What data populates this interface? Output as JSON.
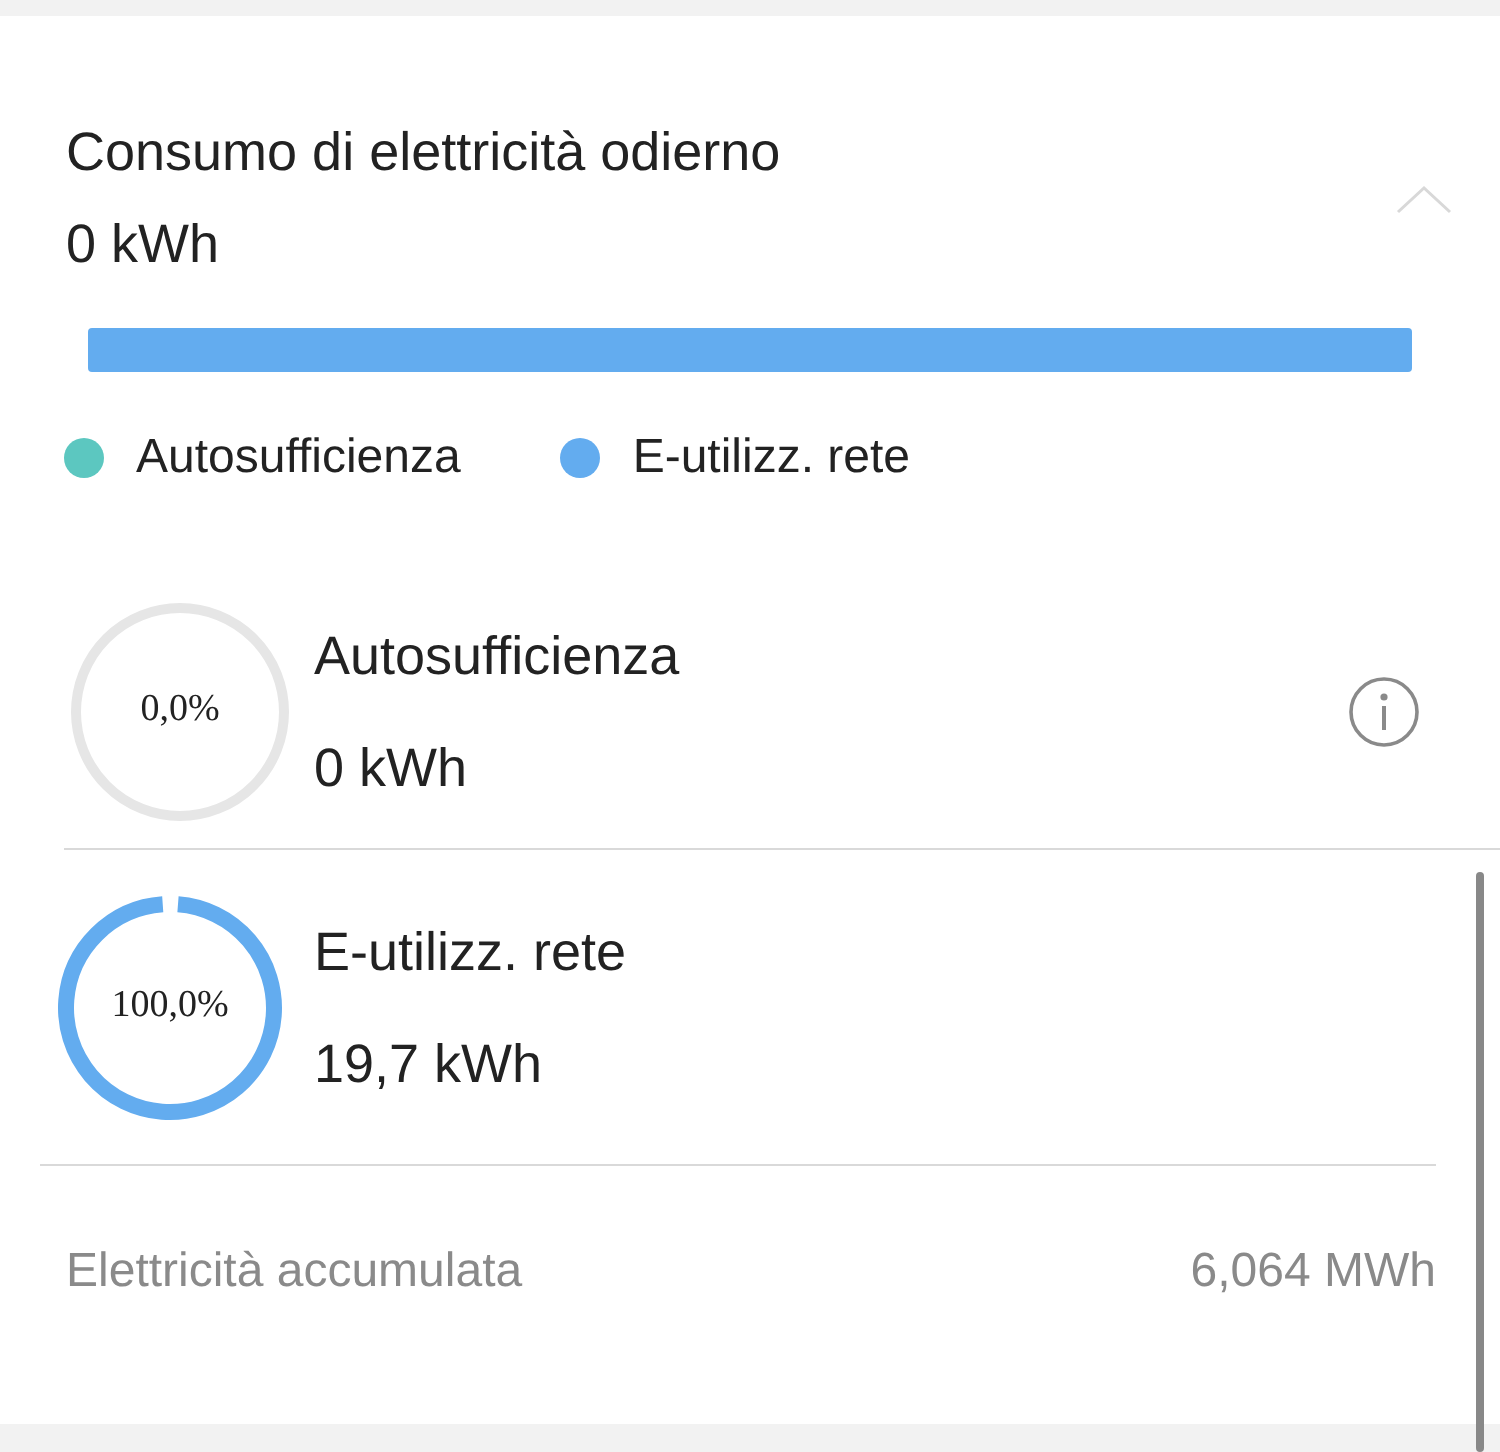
{
  "title": "Consumo di elettricità odierno",
  "total": "0 kWh",
  "expanded": true,
  "bar": [
    {
      "color": "#63acef",
      "level": 1
    }
  ],
  "legend": [
    {
      "label": "Autosufficienza",
      "color": "#5cc7c0"
    },
    {
      "label": "E-utilizz. rete",
      "color": "#63acef"
    }
  ],
  "rows": [
    {
      "percent": "0,0%",
      "filled": false,
      "label": "Autosufficienza",
      "value": "0 kWh",
      "info": true
    },
    {
      "percent": "100,0%",
      "filled": true,
      "color": "#63acef",
      "label": "E-utilizz. rete",
      "value": "19,7 kWh",
      "info": false
    }
  ],
  "footer": {
    "label": "Elettricità accumulata",
    "value": "6,064 MWh"
  }
}
